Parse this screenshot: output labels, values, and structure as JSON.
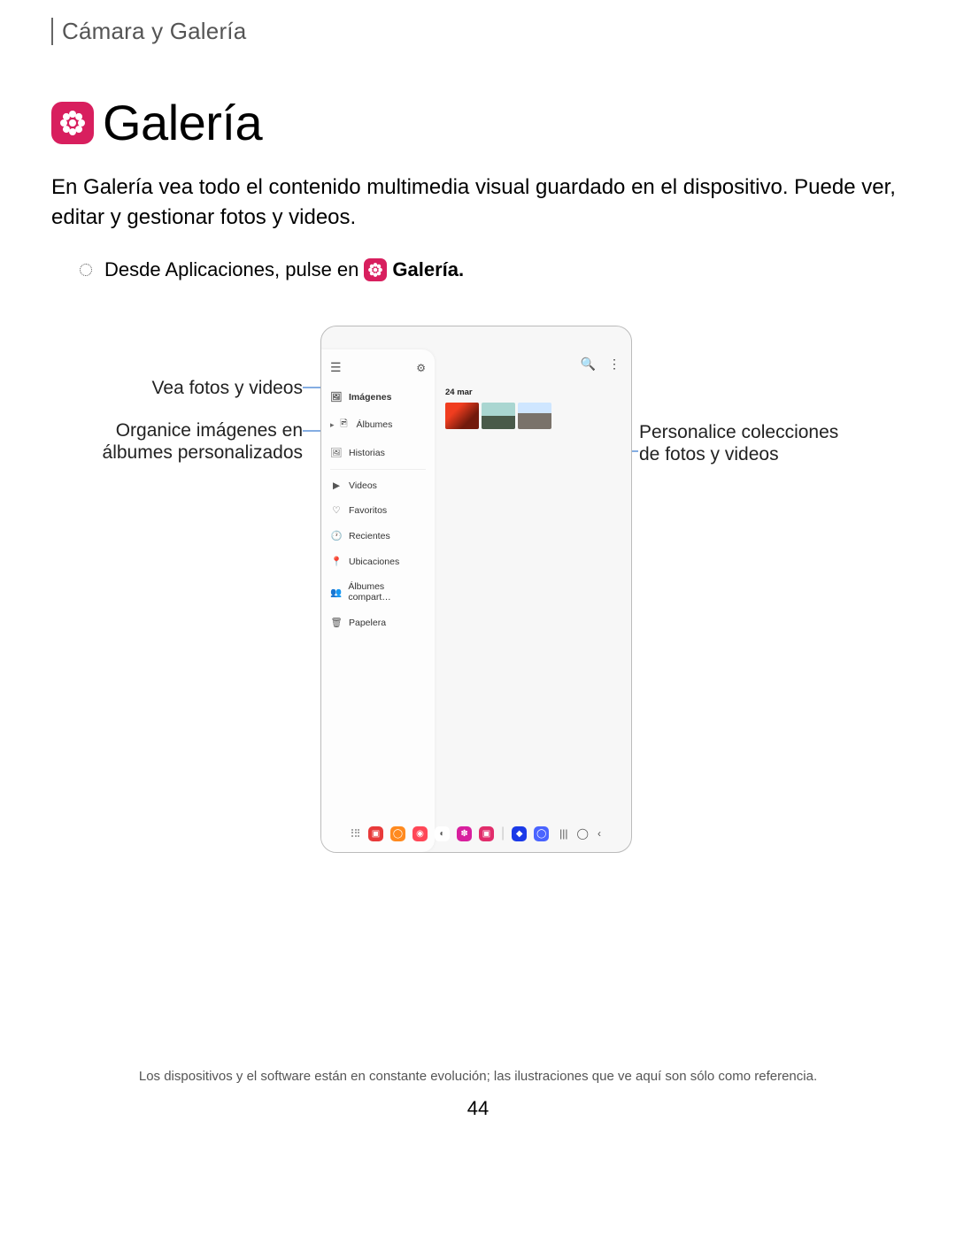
{
  "breadcrumb": "Cámara y Galería",
  "title": "Galería",
  "intro": "En Galería vea todo el contenido multimedia visual guardado en el dispositivo. Puede ver, editar y gestionar fotos y videos.",
  "step_prefix": "Desde Aplicaciones, pulse en",
  "step_app": "Galería.",
  "callouts": {
    "left1": "Vea fotos y videos",
    "left2": "Organice imágenes en álbumes personalizados",
    "right1": "Personalice colecciones de fotos y videos"
  },
  "phone": {
    "date": "24 mar",
    "sidebar": [
      "Imágenes",
      "Álbumes",
      "Historias",
      "Videos",
      "Favoritos",
      "Recientes",
      "Ubicaciones",
      "Álbumes compart…",
      "Papelera"
    ]
  },
  "disclaimer": "Los dispositivos y el software están en constante evolución; las ilustraciones que ve aquí son sólo como referencia.",
  "pagenum": "44"
}
